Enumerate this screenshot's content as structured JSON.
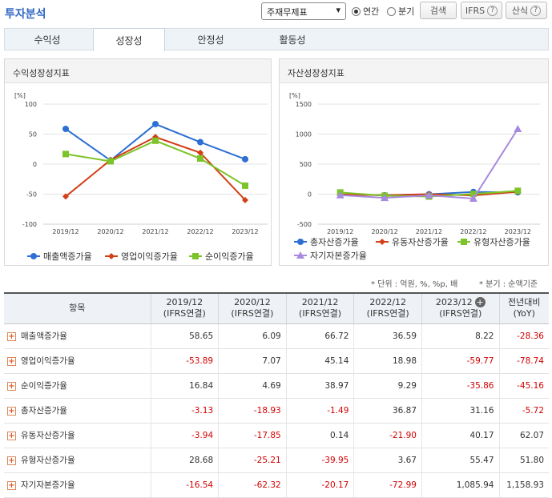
{
  "header": {
    "title": "투자분석",
    "select_value": "주재무제표",
    "radio_annual": "연간",
    "radio_quarter": "분기",
    "search_label": "검색",
    "ifrs_label": "IFRS",
    "calc_label": "산식",
    "help": "?"
  },
  "tabs": [
    "수익성",
    "성장성",
    "안정성",
    "활동성"
  ],
  "active_tab": "성장성",
  "note_unit": "* 단위 : 억원, %, %p, 배",
  "note_quarter": "* 분기 : 순액기준",
  "colors": {
    "blue": "#2d6fd3",
    "red": "#d14017",
    "green": "#7dc42a",
    "purple": "#a98ae0"
  },
  "chart_data": [
    {
      "type": "line",
      "title": "수익성장성지표",
      "ylabel": "[%]",
      "categories": [
        "2019/12",
        "2020/12",
        "2021/12",
        "2022/12",
        "2023/12"
      ],
      "ylim": [
        -100,
        100
      ],
      "yticks": [
        "100",
        "50",
        "0",
        "-50",
        "-100"
      ],
      "series": [
        {
          "name": "매출액증가율",
          "color": "#2d6fd3",
          "marker": "circle",
          "values": [
            58.65,
            6.09,
            66.72,
            36.59,
            8.22
          ]
        },
        {
          "name": "영업이익증가율",
          "color": "#d14017",
          "marker": "diamond",
          "values": [
            -53.89,
            7.07,
            45.14,
            18.98,
            -59.77
          ]
        },
        {
          "name": "순이익증가율",
          "color": "#7dc42a",
          "marker": "square",
          "values": [
            16.84,
            4.69,
            38.97,
            9.29,
            -35.86
          ]
        }
      ]
    },
    {
      "type": "line",
      "title": "자산성장성지표",
      "ylabel": "[%]",
      "categories": [
        "2019/12",
        "2020/12",
        "2021/12",
        "2022/12",
        "2023/12"
      ],
      "ylim": [
        -500,
        1500
      ],
      "yticks": [
        "1500",
        "1000",
        "500",
        "0",
        "-500"
      ],
      "series": [
        {
          "name": "총자산증가율",
          "color": "#2d6fd3",
          "marker": "circle",
          "values": [
            -3.13,
            -18.93,
            -1.49,
            36.87,
            31.16
          ]
        },
        {
          "name": "유동자산증가율",
          "color": "#d14017",
          "marker": "diamond",
          "values": [
            -3.94,
            -17.85,
            0.14,
            -21.9,
            40.17
          ]
        },
        {
          "name": "유형자산증가율",
          "color": "#7dc42a",
          "marker": "square",
          "values": [
            28.68,
            -25.21,
            -39.95,
            3.67,
            55.47
          ]
        },
        {
          "name": "자기자본증가율",
          "color": "#a98ae0",
          "marker": "triangle",
          "values": [
            -16.54,
            -62.32,
            -20.17,
            -72.99,
            1085.94
          ]
        }
      ]
    }
  ],
  "table": {
    "headers": [
      {
        "l1": "항목",
        "l2": ""
      },
      {
        "l1": "2019/12",
        "l2": "(IFRS연결)"
      },
      {
        "l1": "2020/12",
        "l2": "(IFRS연결)"
      },
      {
        "l1": "2021/12",
        "l2": "(IFRS연결)"
      },
      {
        "l1": "2022/12",
        "l2": "(IFRS연결)"
      },
      {
        "l1": "2023/12",
        "l2": "(IFRS연결)"
      },
      {
        "l1": "전년대비",
        "l2": "(YoY)"
      }
    ],
    "rows": [
      {
        "label": "매출액증가율",
        "values": [
          "58.65",
          "6.09",
          "66.72",
          "36.59",
          "8.22",
          "-28.36"
        ]
      },
      {
        "label": "영업이익증가율",
        "values": [
          "-53.89",
          "7.07",
          "45.14",
          "18.98",
          "-59.77",
          "-78.74"
        ]
      },
      {
        "label": "순이익증가율",
        "values": [
          "16.84",
          "4.69",
          "38.97",
          "9.29",
          "-35.86",
          "-45.16"
        ]
      },
      {
        "label": "총자산증가율",
        "values": [
          "-3.13",
          "-18.93",
          "-1.49",
          "36.87",
          "31.16",
          "-5.72"
        ]
      },
      {
        "label": "유동자산증가율",
        "values": [
          "-3.94",
          "-17.85",
          "0.14",
          "-21.90",
          "40.17",
          "62.07"
        ]
      },
      {
        "label": "유형자산증가율",
        "values": [
          "28.68",
          "-25.21",
          "-39.95",
          "3.67",
          "55.47",
          "51.80"
        ]
      },
      {
        "label": "자기자본증가율",
        "values": [
          "-16.54",
          "-62.32",
          "-20.17",
          "-72.99",
          "1,085.94",
          "1,158.93"
        ]
      }
    ]
  }
}
